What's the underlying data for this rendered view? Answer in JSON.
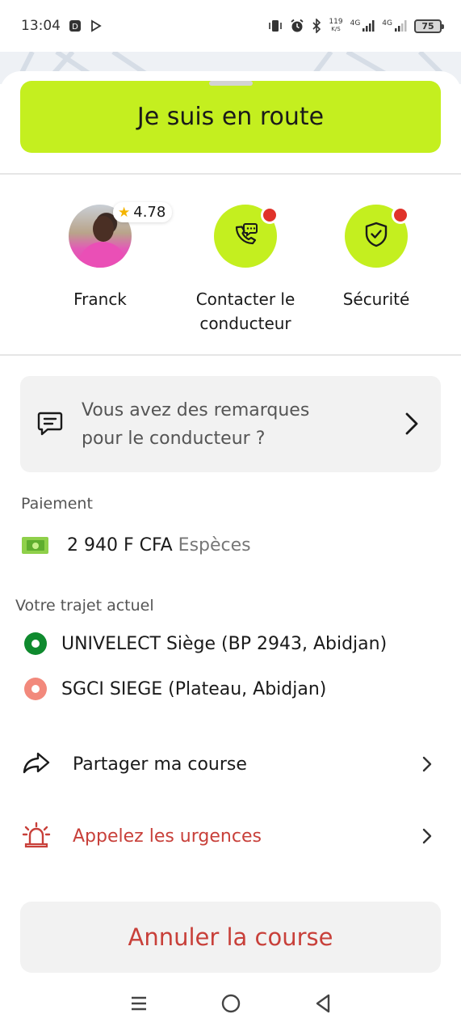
{
  "status_bar": {
    "time": "13:04",
    "speed_value": "119",
    "speed_unit": "K/S",
    "network_1": "4G",
    "network_2": "4G",
    "battery": "75",
    "icons": [
      "notification-d-icon",
      "play-store-icon",
      "vibrate-icon",
      "alarm-icon",
      "bluetooth-icon",
      "signal-icon",
      "battery-icon"
    ]
  },
  "header": {
    "status_button_label": "Je suis en route"
  },
  "driver": {
    "name": "Franck",
    "rating": "4.78"
  },
  "actions": {
    "contact_label_line1": "Contacter le",
    "contact_label_line2": "conducteur",
    "security_label": "Sécurité"
  },
  "remarks": {
    "line1": "Vous avez des remarques",
    "line2": "pour le conducteur ?"
  },
  "payment": {
    "section_label": "Paiement",
    "amount": "2 940 F CFA",
    "method": "Espèces"
  },
  "trip": {
    "section_label": "Votre trajet actuel",
    "origin": "UNIVELECT Siège (BP 2943, Abidjan)",
    "destination": "SGCI SIEGE (Plateau, Abidjan)"
  },
  "options": {
    "share_label": "Partager ma course",
    "emergency_label": "Appelez les urgences"
  },
  "cancel_button_label": "Annuler la course",
  "colors": {
    "accent": "#c4ef1f",
    "danger": "#c8403a",
    "origin_dot": "#0f8a2e",
    "destination_dot": "#f2897c"
  }
}
